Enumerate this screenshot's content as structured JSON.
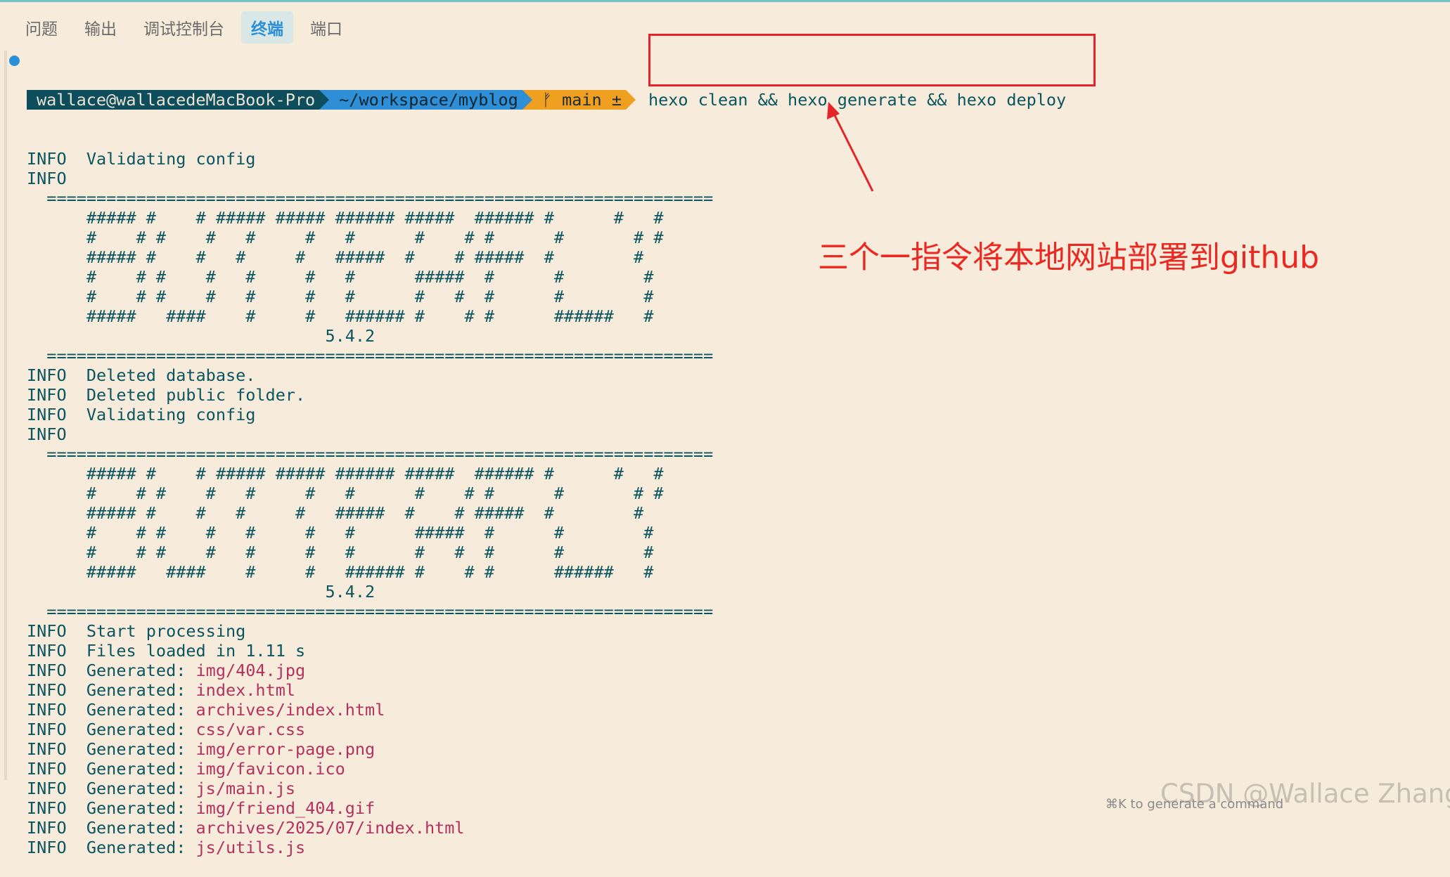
{
  "panel_tabs": [
    {
      "label": "问题"
    },
    {
      "label": "输出"
    },
    {
      "label": "调试控制台"
    },
    {
      "label": "终端"
    },
    {
      "label": "端口"
    }
  ],
  "prompt": {
    "user_host": "wallace@wallacedeMacBook-Pro",
    "path": "~/workspace/myblog",
    "branch_glyph": "ᚠ",
    "branch": "main ±",
    "command": "hexo clean && hexo generate && hexo deploy"
  },
  "output": {
    "pre_banner_1": [
      "INFO  Validating config",
      "INFO"
    ],
    "banner_1": [
      "  ===================================================================",
      "      ##### #    # ##### ##### ###### #####  ###### #      #   #",
      "      #    # #    #   #     #   #      #    # #      #       # #",
      "      ##### #    #   #     #   #####  #    # #####  #        #",
      "      #    # #    #   #     #   #      #####  #      #        #",
      "      #    # #    #   #     #   #      #   #  #      #        #",
      "      #####   ####    #     #   ###### #    # #      ######   #",
      "                              5.4.2",
      "  ==================================================================="
    ],
    "middle": [
      "INFO  Deleted database.",
      "INFO  Deleted public folder.",
      "INFO  Validating config",
      "INFO"
    ],
    "banner_2": [
      "  ===================================================================",
      "      ##### #    # ##### ##### ###### #####  ###### #      #   #",
      "      #    # #    #   #     #   #      #    # #      #       # #",
      "      ##### #    #   #     #   #####  #    # #####  #        #",
      "      #    # #    #   #     #   #      #####  #      #        #",
      "      #    # #    #   #     #   #      #   #  #      #        #",
      "      #####   ####    #     #   ###### #    # #      ######   #",
      "                              5.4.2",
      "  ==================================================================="
    ],
    "processing": [
      "INFO  Start processing",
      "INFO  Files loaded in 1.11 s"
    ],
    "generated_prefix": "INFO  Generated: ",
    "generated_files": [
      "img/404.jpg",
      "index.html",
      "archives/index.html",
      "css/var.css",
      "img/error-page.png",
      "img/favicon.ico",
      "js/main.js",
      "img/friend_404.gif",
      "archives/2025/07/index.html",
      "js/utils.js"
    ]
  },
  "annotation": {
    "text": "三个一指令将本地网站部署到github"
  },
  "footer_hint": "⌘K to generate a command",
  "watermark": "CSDN @Wallace Zhang",
  "colors": {
    "background": "#f7ecdb",
    "terminal_text": "#0b5560",
    "file_text": "#b2315f",
    "annotation_red": "#e5242a",
    "tab_active": "#2a8fd6"
  }
}
